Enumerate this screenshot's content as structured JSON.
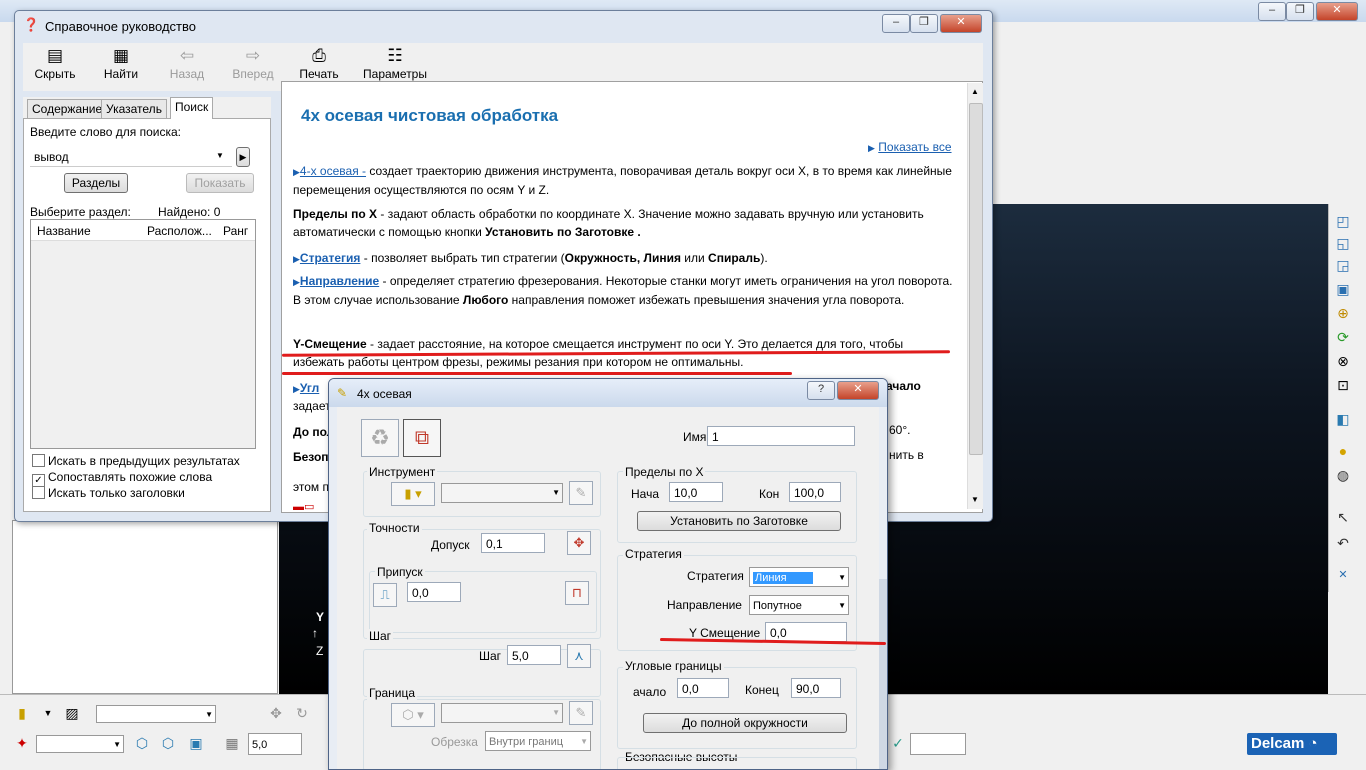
{
  "app": {
    "title": "",
    "logo": "Delcam",
    "bottom_value": "5,0"
  },
  "help": {
    "title": "Справочное руководство",
    "toolbar": {
      "hide": "Скрыть",
      "find": "Найти",
      "back": "Назад",
      "forward": "Вперед",
      "print": "Печать",
      "options": "Параметры"
    },
    "tabs": [
      "Содержание",
      "Указатель",
      "Поиск"
    ],
    "search": {
      "prompt": "Введите слово для поиска:",
      "value": "вывод",
      "sections_btn": "Разделы",
      "show_btn": "Показать",
      "choose_label": "Выберите раздел:",
      "found_label": "Найдено: 0",
      "columns": [
        "Название",
        "Располож...",
        "Ранг"
      ],
      "checkboxes": [
        {
          "label": "Искать в предыдущих результатах",
          "checked": false
        },
        {
          "label": "Сопоставлять похожие слова",
          "checked": true
        },
        {
          "label": "Искать только заголовки",
          "checked": false
        }
      ]
    },
    "content": {
      "heading": "4х осевая чистовая обработка",
      "show_all": "Показать все",
      "p1_link": "4-х осевая -",
      "p1_text": " создает траекторию движения инструмента, поворачивая деталь вокруг оси X, в то время как линейные перемещения осуществляются по осям Y и Z.",
      "p2_bold": "Пределы по X",
      "p2_text": " - задают область обработки по координате X. Значение можно задавать вручную или установить автоматически с помощью кнопки ",
      "p2_bold2": "Установить по Заготовке .",
      "p3_link": "Стратегия",
      "p3_text1": " - позволяет выбрать тип стратегии (",
      "p3_bold1": "Окружность, Линия",
      "p3_text2": " или ",
      "p3_bold2": "Спираль",
      "p3_text3": ").",
      "p4_link": "Направление",
      "p4_text1": " - определяет стратегию фрезерования. Некоторые станки могут иметь ограничения на угол поворота. В этом случае использование ",
      "p4_bold": "Любого",
      "p4_text2": " направления поможет избежать превышения значения угла поворота.",
      "p5_bold": "Y-Смещение",
      "p5_text": " - задает расстояние, на которое смещается инструмент по оси Y. Это делается для того, чтобы избежать работы центром фрезы, режимы резания при котором не оптимальны.",
      "p6_link": "Угл",
      "p6_tail": "ачало",
      "p6_line2": "задает",
      "p7_start": "До пол",
      "p7_tail": "60°.",
      "p8_start": "Безоп",
      "p8_tail": "нить в",
      "p9_start": "этом п"
    }
  },
  "dialog": {
    "title": "4х осевая",
    "name_label": "Имя",
    "name_value": "1",
    "tool_group": "Инструмент",
    "tolerance_group": "Точности",
    "tolerance_label": "Допуск",
    "tolerance_value": "0,1",
    "allowance_group": "Припуск",
    "allowance_value": "0,0",
    "step_group": "Шаг",
    "step_label": "Шаг",
    "step_value": "5,0",
    "boundary_group": "Граница",
    "trim_label": "Обрезка",
    "trim_value": "Внутри границ",
    "xlimits_group": "Пределы по X",
    "start_label": "Нача",
    "start_value": "10,0",
    "end_label": "Кон",
    "end_value": "100,0",
    "set_stock_btn": "Установить по Заготовке",
    "strategy_group": "Стратегия",
    "strategy_label": "Стратегия",
    "strategy_value": "Линия",
    "direction_label": "Направление",
    "direction_value": "Попутное",
    "yoffset_label": "Y Смещение",
    "yoffset_value": "0,0",
    "angular_group": "Угловые границы",
    "ang_start_label": "ачало",
    "ang_start_value": "0,0",
    "ang_end_label": "Конец",
    "ang_end_value": "90,0",
    "full_circle_btn": "До полной окружности",
    "safe_heights_group": "Безопасные высоты"
  }
}
